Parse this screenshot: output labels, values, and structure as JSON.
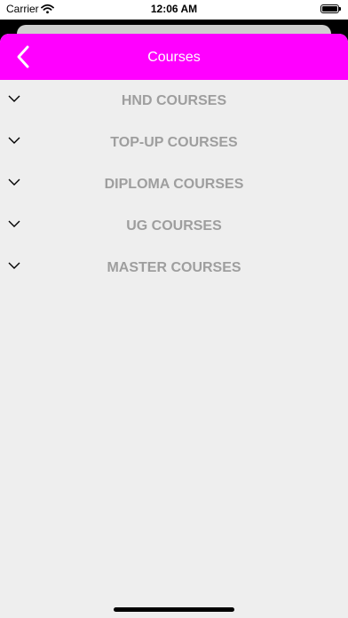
{
  "status_bar": {
    "carrier": "Carrier",
    "time": "12:06 AM"
  },
  "nav": {
    "title": "Courses",
    "back_icon": "chevron-left-icon",
    "background_color": "#ff00ff"
  },
  "courses": [
    {
      "label": "HND COURSES",
      "icon": "chevron-down-icon"
    },
    {
      "label": "TOP-UP COURSES",
      "icon": "chevron-down-icon"
    },
    {
      "label": "DIPLOMA COURSES",
      "icon": "chevron-down-icon"
    },
    {
      "label": "UG COURSES",
      "icon": "chevron-down-icon"
    },
    {
      "label": "MASTER COURSES",
      "icon": "chevron-down-icon"
    }
  ],
  "colors": {
    "accent": "#ff00ff",
    "row_text": "#9e9e9e",
    "sheet_background": "#eeeeee"
  }
}
